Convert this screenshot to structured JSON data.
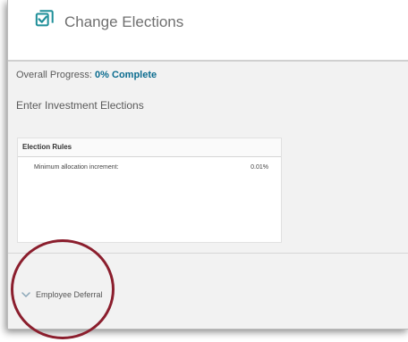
{
  "header": {
    "icon": "checklist-edit-icon",
    "title": "Change Elections"
  },
  "progress": {
    "label": "Overall Progress:",
    "value": "0% Complete"
  },
  "section": {
    "title": "Enter Investment Elections"
  },
  "election_rules": {
    "title": "Election Rules",
    "rows": [
      {
        "label": "Minimum allocation increment:",
        "value": "0.01%"
      }
    ]
  },
  "deferral": {
    "icon": "chevron-down-icon",
    "label": "Employee Deferral"
  },
  "colors": {
    "accent": "#0b6c8f",
    "annotation": "#8b1e2d"
  }
}
